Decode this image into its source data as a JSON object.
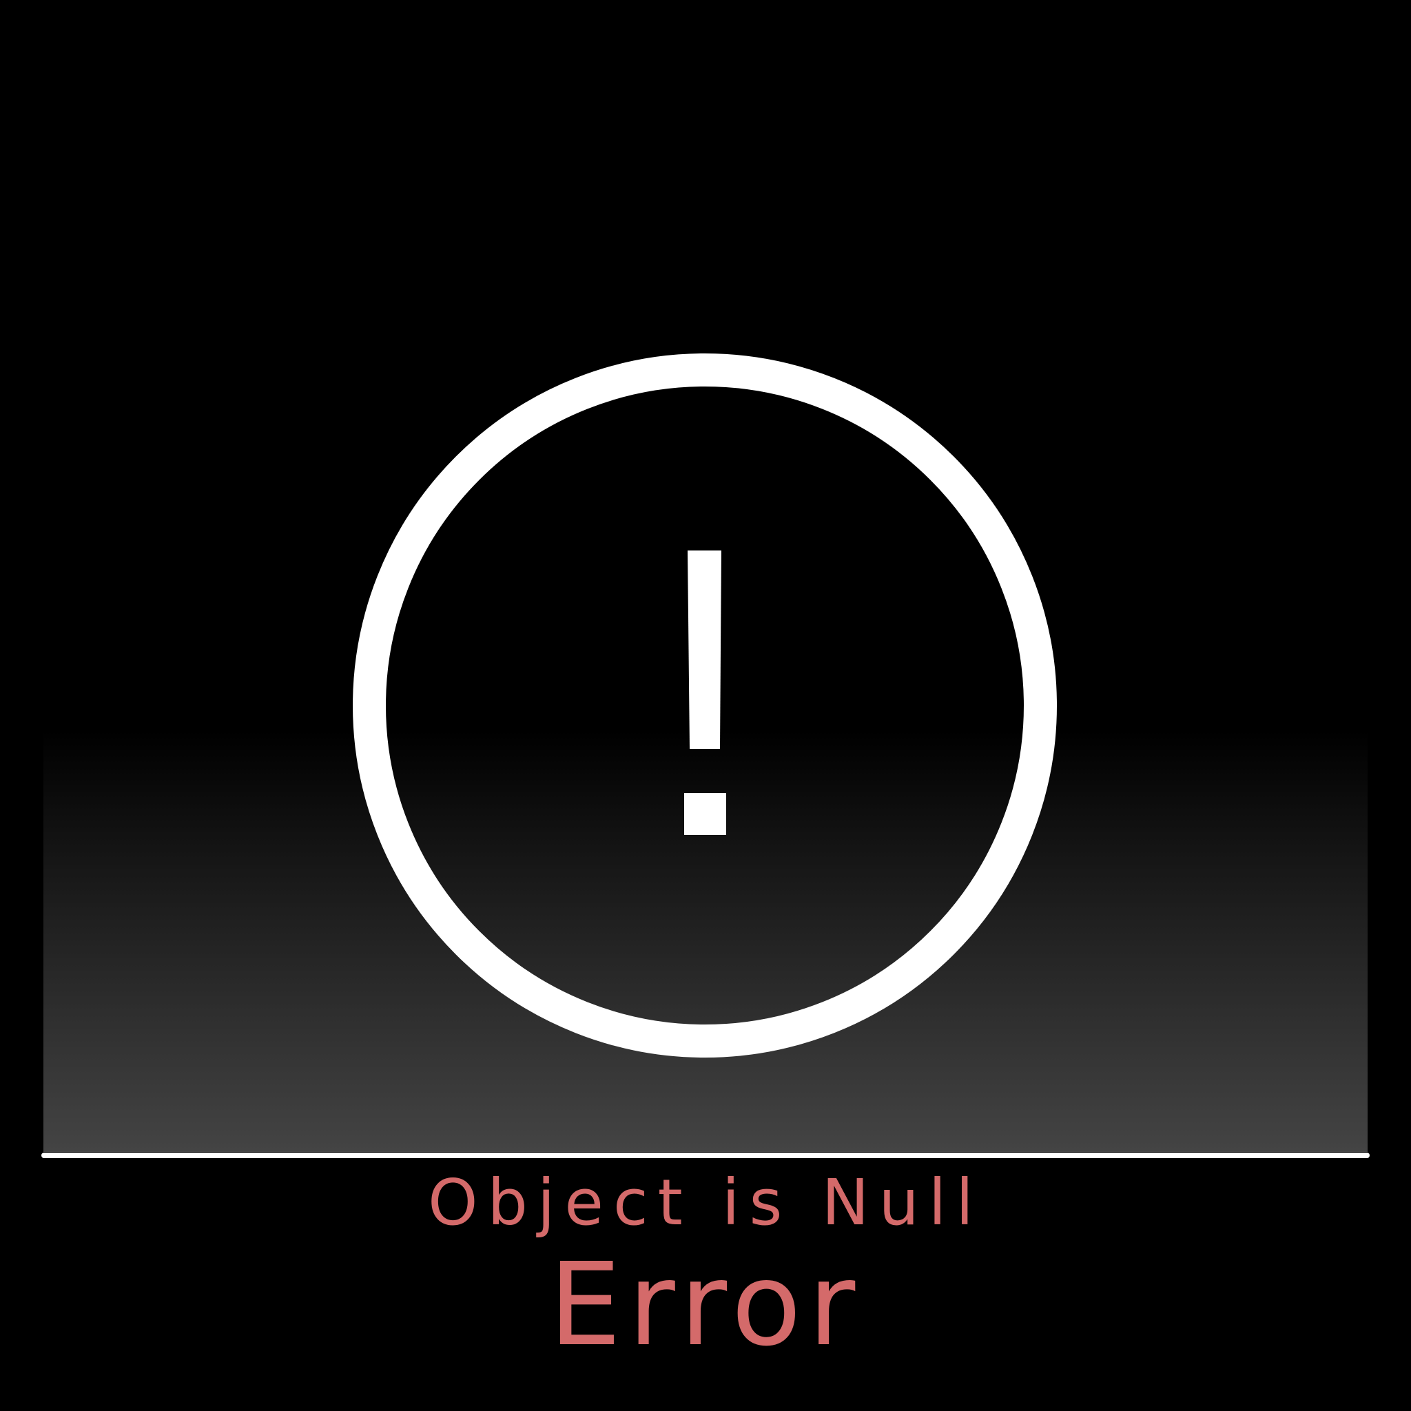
{
  "colors": {
    "background": "#000000",
    "icon": "#ffffff",
    "message_text": "#d46a6a"
  },
  "icon": {
    "name": "exclamation-circle-icon",
    "glyph": "!"
  },
  "message": {
    "subtitle": "Object is Null",
    "title": "Error"
  }
}
